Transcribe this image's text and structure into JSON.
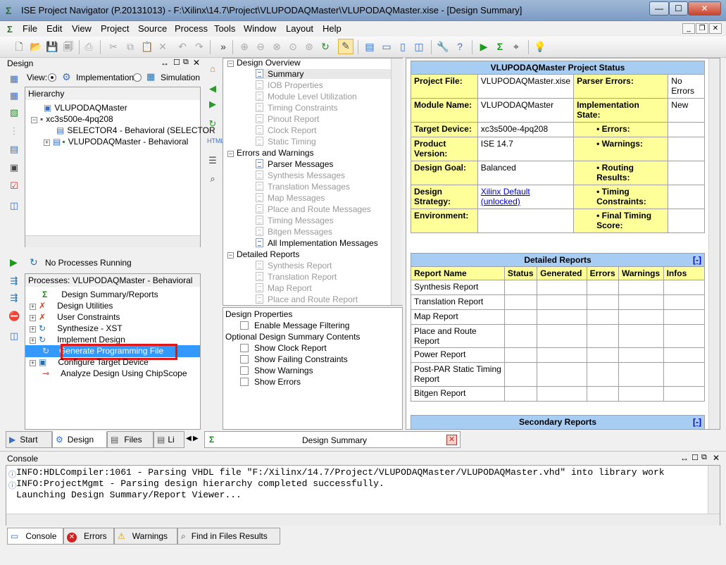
{
  "window": {
    "title": "ISE Project Navigator (P.20131013) - F:\\Xilinx\\14.7\\Project\\VLUPODAQMaster\\VLUPODAQMaster.xise - [Design Summary]",
    "min_glyph": "—",
    "max_glyph": "☐",
    "close_glyph": "✕"
  },
  "menu": [
    "File",
    "Edit",
    "View",
    "Project",
    "Source",
    "Process",
    "Tools",
    "Window",
    "Layout",
    "Help"
  ],
  "design_panel": {
    "title": "Design",
    "view_label": "View:",
    "implementation_label": "Implementation",
    "simulation_label": "Simulation",
    "hierarchy_label": "Hierarchy",
    "tree": [
      "VLUPODAQMaster",
      "xc3s500e-4pq208",
      "SELECTOR4 - Behavioral (SELECTOR",
      "VLUPODAQMaster - Behavioral"
    ]
  },
  "processes_panel": {
    "status": "No Processes Running",
    "header": "Processes: VLUPODAQMaster - Behavioral",
    "items": [
      "Design Summary/Reports",
      "Design Utilities",
      "User Constraints",
      "Synthesize - XST",
      "Implement Design",
      "Generate Programming File",
      "Configure Target Device",
      "Analyze Design Using ChipScope"
    ],
    "selected_index": 5
  },
  "bottom_left_tabs": [
    "Start",
    "Design",
    "Files",
    "Li"
  ],
  "summary_tree": {
    "sections": [
      {
        "title": "Design Overview",
        "items": [
          "Summary",
          "IOB Properties",
          "Module Level Utilization",
          "Timing Constraints",
          "Pinout Report",
          "Clock Report",
          "Static Timing"
        ]
      },
      {
        "title": "Errors and Warnings",
        "items": [
          "Parser Messages",
          "Synthesis Messages",
          "Translation Messages",
          "Map Messages",
          "Place and Route Messages",
          "Timing Messages",
          "Bitgen Messages",
          "All Implementation Messages"
        ]
      },
      {
        "title": "Detailed Reports",
        "items": [
          "Synthesis Report",
          "Translation Report",
          "Map Report",
          "Place and Route Report"
        ]
      }
    ]
  },
  "design_properties": {
    "title": "Design Properties",
    "enable_filtering": "Enable Message Filtering",
    "optional_title": "Optional Design Summary Contents",
    "options": [
      "Show Clock Report",
      "Show Failing Constraints",
      "Show Warnings",
      "Show Errors"
    ]
  },
  "project_status": {
    "title": "VLUPODAQMaster Project Status",
    "project_file_label": "Project File:",
    "project_file": "VLUPODAQMaster.xise",
    "parser_errors_label": "Parser Errors:",
    "parser_errors": "No Errors",
    "module_name_label": "Module Name:",
    "module_name": "VLUPODAQMaster",
    "impl_state_label": "Implementation State:",
    "impl_state": "New",
    "target_device_label": "Target Device:",
    "target_device": "xc3s500e-4pq208",
    "errors_label": "• Errors:",
    "product_version_label": "Product Version:",
    "product_version": "ISE 14.7",
    "warnings_label": "• Warnings:",
    "design_goal_label": "Design Goal:",
    "design_goal": "Balanced",
    "routing_label": "• Routing Results:",
    "design_strategy_label": "Design Strategy:",
    "design_strategy": "Xilinx Default (unlocked)",
    "timing_label": "• Timing Constraints:",
    "environment_label": "Environment:",
    "final_timing_label": "• Final Timing Score:"
  },
  "detailed_reports": {
    "title": "Detailed Reports",
    "collapse": "[-]",
    "columns": [
      "Report Name",
      "Status",
      "Generated",
      "Errors",
      "Warnings",
      "Infos"
    ],
    "rows": [
      "Synthesis Report",
      "Translation Report",
      "Map Report",
      "Place and Route Report",
      "Power Report",
      "Post-PAR Static Timing Report",
      "Bitgen Report"
    ]
  },
  "secondary_reports": {
    "title": "Secondary Reports",
    "collapse": "[-]"
  },
  "editor_tab": "Design Summary",
  "console": {
    "title": "Console",
    "lines": [
      "INFO:HDLCompiler:1061 - Parsing VHDL file \"F:/Xilinx/14.7/Project/VLUPODAQMaster/VLUPODAQMaster.vhd\" into library work",
      "INFO:ProjectMgmt - Parsing design hierarchy completed successfully.",
      "Launching Design Summary/Report Viewer..."
    ],
    "tabs": [
      "Console",
      "Errors",
      "Warnings",
      "Find in Files Results"
    ]
  }
}
